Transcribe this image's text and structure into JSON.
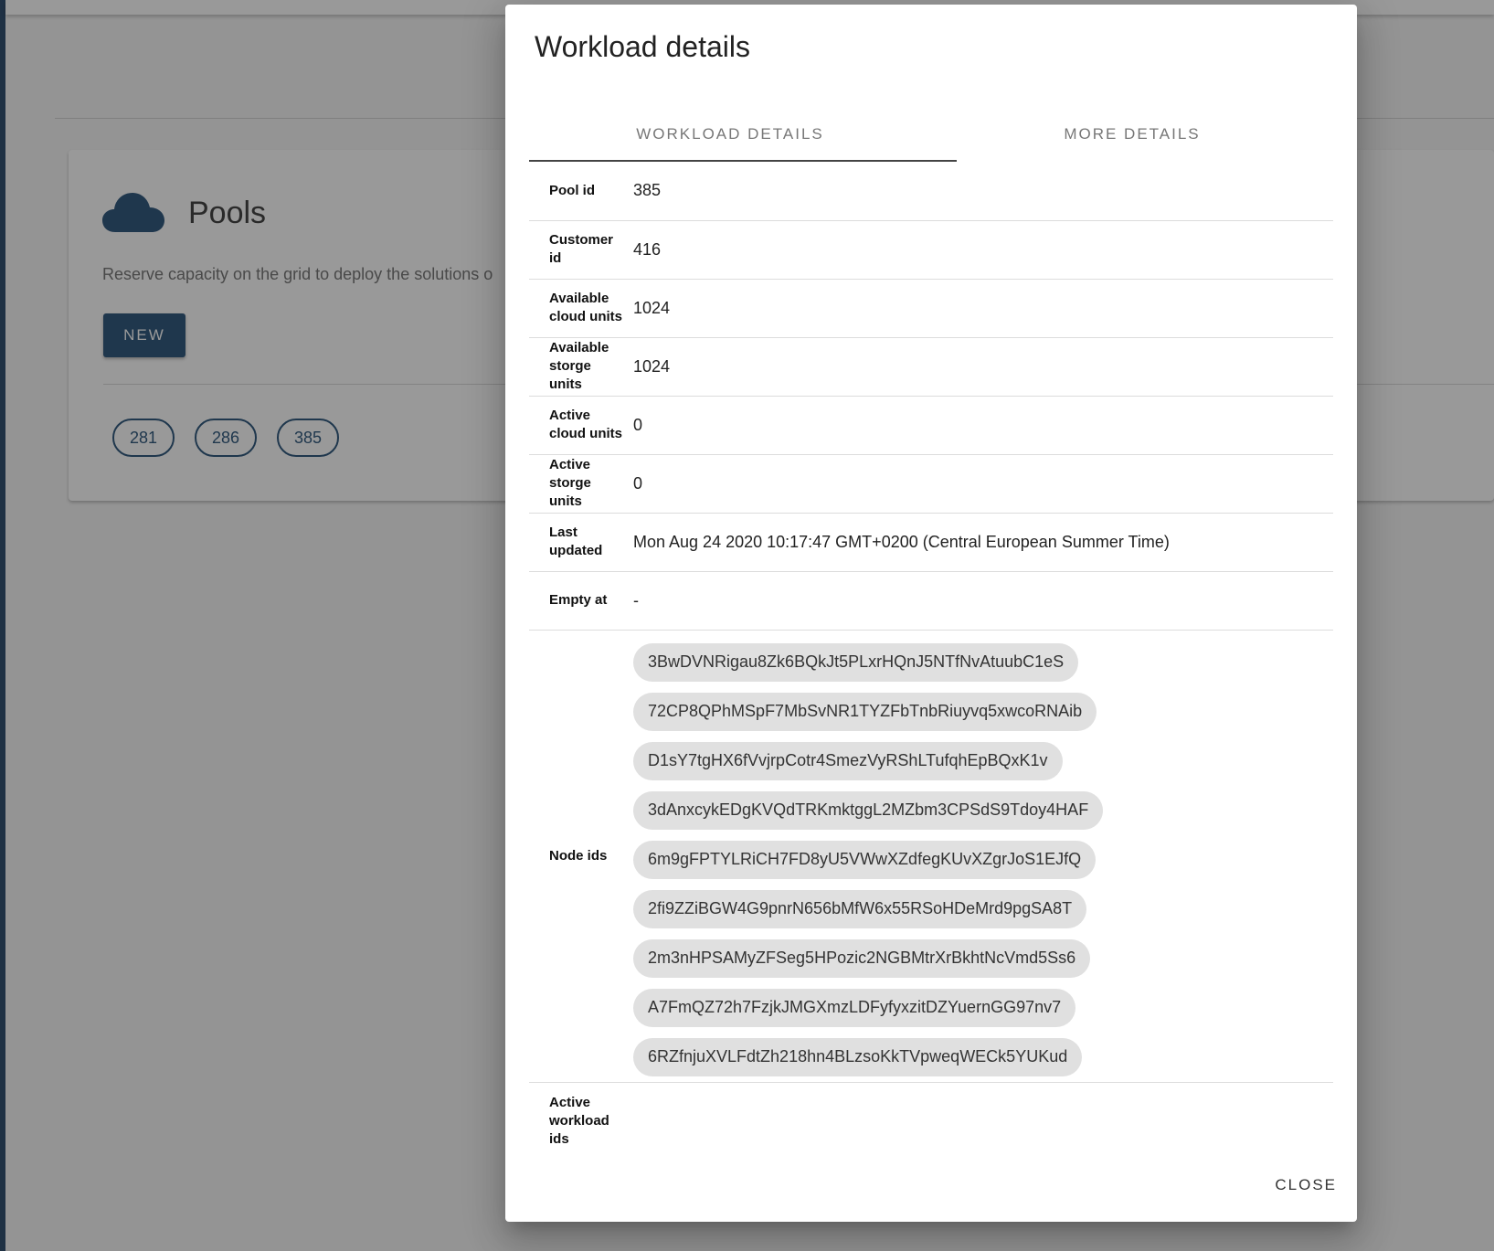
{
  "background": {
    "pools": {
      "title": "Pools",
      "icon": "cloud-icon",
      "description": "Reserve capacity on the grid to deploy the solutions o",
      "new_label": "NEW",
      "pool_ids": [
        "281",
        "286",
        "385"
      ]
    }
  },
  "dialog": {
    "title": "Workload details",
    "tabs": [
      {
        "label": "WORKLOAD DETAILS",
        "active": true
      },
      {
        "label": "MORE DETAILS",
        "active": false
      }
    ],
    "rows": {
      "pool_id": {
        "label": "Pool id",
        "value": "385"
      },
      "customer_id": {
        "label": "Customer id",
        "value": "416"
      },
      "available_cloud_units": {
        "label": "Available cloud units",
        "value": "1024"
      },
      "available_storge_units": {
        "label": "Available storge units",
        "value": "1024"
      },
      "active_cloud_units": {
        "label": "Active cloud units",
        "value": "0"
      },
      "active_storge_units": {
        "label": "Active storge units",
        "value": "0"
      },
      "last_updated": {
        "label": "Last updated",
        "value": "Mon Aug 24 2020 10:17:47 GMT+0200 (Central European Summer Time)"
      },
      "empty_at": {
        "label": "Empty at",
        "value": "-"
      },
      "node_ids": {
        "label": "Node ids",
        "values": [
          "3BwDVNRigau8Zk6BQkJt5PLxrHQnJ5NTfNvAtuubC1eS",
          "72CP8QPhMSpF7MbSvNR1TYZFbTnbRiuyvq5xwcoRNAib",
          "D1sY7tgHX6fVvjrpCotr4SmezVyRShLTufqhEpBQxK1v",
          "3dAnxcykEDgKVQdTRKmktggL2MZbm3CPSdS9Tdoy4HAF",
          "6m9gFPTYLRiCH7FD8yU5VWwXZdfegKUvXZgrJoS1EJfQ",
          "2fi9ZZiBGW4G9pnrN656bMfW6x55RSoHDeMrd9pgSA8T",
          "2m3nHPSAMyZFSeg5HPozic2NGBMtrXrBkhtNcVmd5Ss6",
          "A7FmQZ72h7FzjkJMGXmzLDFyfyxzitDZYuernGG97nv7",
          "6RZfnjuXVLFdtZh218hn4BLzsoKkTVpweqWECk5YUKud"
        ]
      },
      "active_workload_ids": {
        "label": "Active workload ids",
        "value": ""
      }
    },
    "close_label": "CLOSE"
  },
  "colors": {
    "brand": "#1e4a73",
    "rail": "#1e3f63",
    "chip_bg": "#e0e0e0",
    "overlay": "rgba(33,33,33,0.46)"
  }
}
